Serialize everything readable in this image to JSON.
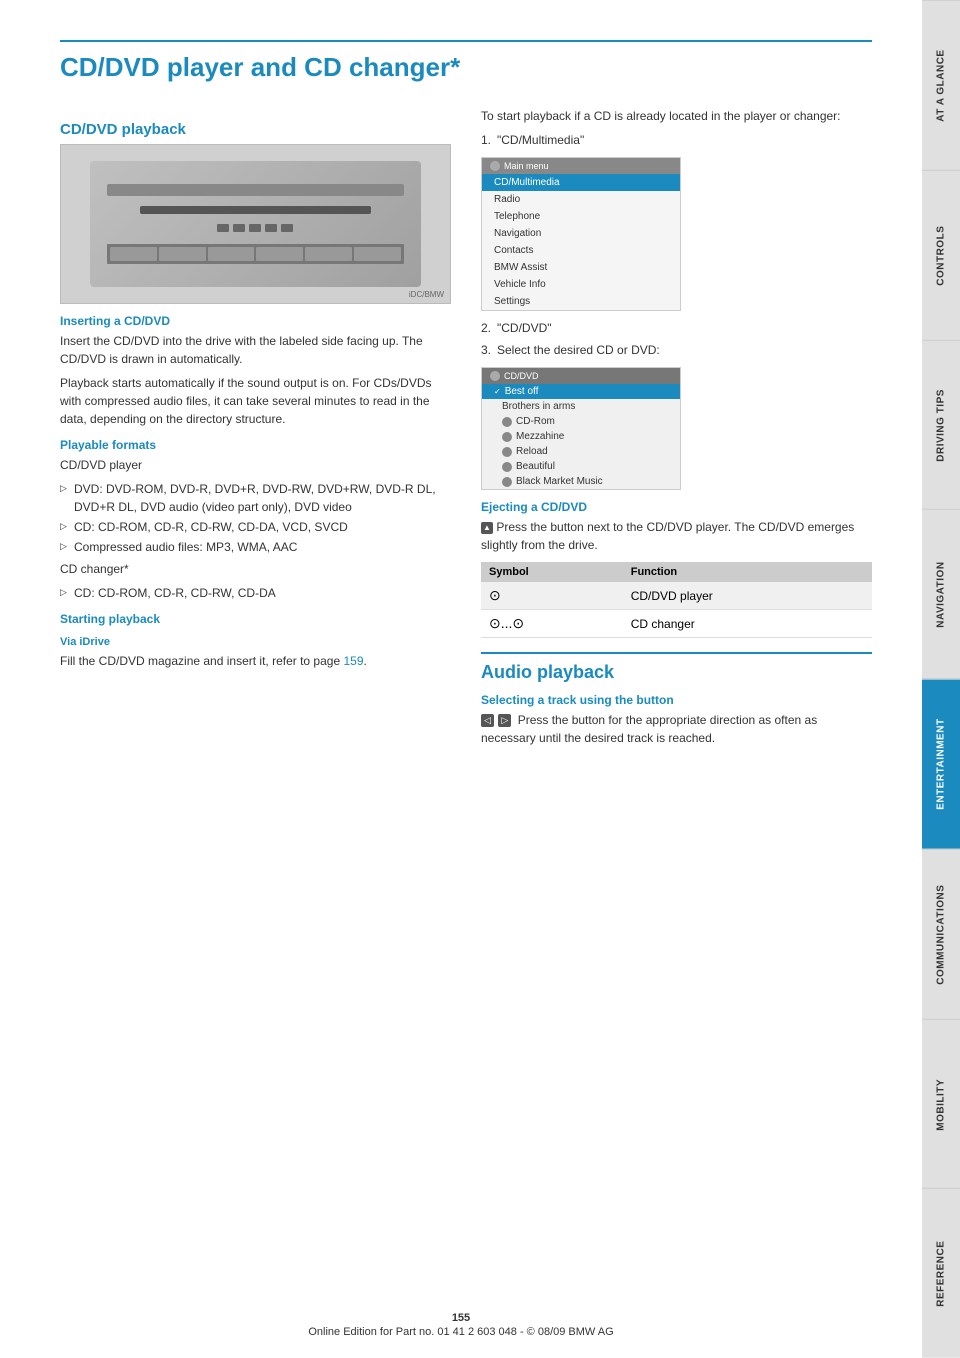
{
  "page": {
    "title": "CD/DVD player and CD changer*",
    "page_number": "155",
    "footer_text": "Online Edition for Part no. 01 41 2 603 048 - © 08/09 BMW AG"
  },
  "sidebar": {
    "tabs": [
      {
        "id": "at-a-glance",
        "label": "At a glance",
        "active": false
      },
      {
        "id": "controls",
        "label": "Controls",
        "active": false
      },
      {
        "id": "driving-tips",
        "label": "Driving tips",
        "active": false
      },
      {
        "id": "navigation",
        "label": "Navigation",
        "active": false
      },
      {
        "id": "entertainment",
        "label": "Entertainment",
        "active": true
      },
      {
        "id": "communications",
        "label": "Communications",
        "active": false
      },
      {
        "id": "mobility",
        "label": "Mobility",
        "active": false
      },
      {
        "id": "reference",
        "label": "Reference",
        "active": false
      }
    ]
  },
  "left_column": {
    "section1": {
      "heading": "CD/DVD playback",
      "inserting_heading": "Inserting a CD/DVD",
      "inserting_text1": "Insert the CD/DVD into the drive with the labeled side facing up. The CD/DVD is drawn in automatically.",
      "inserting_text2": "Playback starts automatically if the sound output is on. For CDs/DVDs with compressed audio files, it can take several minutes to read in the data, depending on the directory structure."
    },
    "playable_formats": {
      "heading": "Playable formats",
      "cd_dvd_player_label": "CD/DVD player",
      "items": [
        "DVD: DVD-ROM, DVD-R, DVD+R, DVD-RW, DVD+RW, DVD-R DL, DVD+R DL, DVD audio (video part only), DVD video",
        "CD: CD-ROM, CD-R, CD-RW, CD-DA, VCD, SVCD",
        "Compressed audio files: MP3, WMA, AAC"
      ],
      "cd_changer_label": "CD changer*",
      "cd_changer_items": [
        "CD: CD-ROM, CD-R, CD-RW, CD-DA"
      ]
    },
    "starting_playback": {
      "heading": "Starting playback",
      "via_idrive_heading": "Via iDrive",
      "via_idrive_text": "Fill the CD/DVD magazine and insert it, refer to page",
      "via_idrive_link": "159",
      "via_idrive_text2": "."
    }
  },
  "right_column": {
    "intro_text": "To start playback if a CD is already located in the player or changer:",
    "steps": [
      {
        "num": "1.",
        "text": "\"CD/Multimedia\""
      },
      {
        "num": "2.",
        "text": "\"CD/DVD\""
      },
      {
        "num": "3.",
        "text": "Select the desired CD or DVD:"
      }
    ],
    "main_menu": {
      "title": "Main menu",
      "items": [
        {
          "label": "CD/Multimedia",
          "highlighted": true
        },
        {
          "label": "Radio",
          "highlighted": false
        },
        {
          "label": "Telephone",
          "highlighted": false
        },
        {
          "label": "Navigation",
          "highlighted": false
        },
        {
          "label": "Contacts",
          "highlighted": false
        },
        {
          "label": "BMW Assist",
          "highlighted": false
        },
        {
          "label": "Vehicle Info",
          "highlighted": false
        },
        {
          "label": "Settings",
          "highlighted": false
        }
      ]
    },
    "cd_menu": {
      "title": "CD/DVD",
      "items": [
        {
          "label": "Best off",
          "highlighted": true,
          "check": true
        },
        {
          "label": "Brothers in arms",
          "highlighted": false
        },
        {
          "label": "CD-Rom",
          "highlighted": false
        },
        {
          "label": "Mezzahine",
          "highlighted": false
        },
        {
          "label": "Reload",
          "highlighted": false
        },
        {
          "label": "Beautiful",
          "highlighted": false
        },
        {
          "label": "Black Market Music",
          "highlighted": false
        }
      ]
    },
    "ejecting": {
      "heading": "Ejecting a CD/DVD",
      "text": "Press the button next to the CD/DVD player. The CD/DVD emerges slightly from the drive."
    },
    "symbol_table": {
      "headers": [
        "Symbol",
        "Function"
      ],
      "rows": [
        {
          "symbol": "⊙",
          "function": "CD/DVD player"
        },
        {
          "symbol": "⊙...⊙",
          "function": "CD changer"
        }
      ]
    },
    "audio_playback": {
      "heading": "Audio playback",
      "selecting_track_heading": "Selecting a track using the button",
      "selecting_track_text": "Press the button for the appropriate direction as often as necessary until the desired track is reached."
    }
  }
}
